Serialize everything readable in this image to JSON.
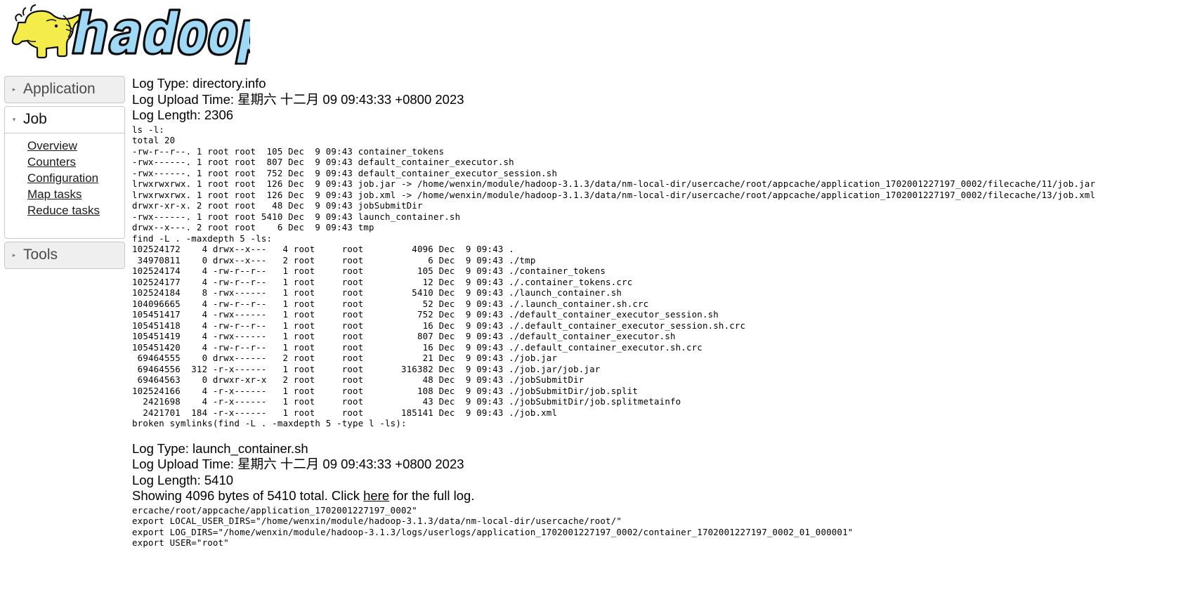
{
  "brand": {
    "name": "hadoop",
    "logo_text": "hadoop",
    "elephant_color": "#f3ec4a",
    "text_color": "#9fd9f6",
    "outline_color": "#000000"
  },
  "sidebar": {
    "sections": [
      {
        "label": "Application",
        "expanded": false,
        "arrow": "▸"
      },
      {
        "label": "Job",
        "expanded": true,
        "arrow": "▾"
      },
      {
        "label": "Tools",
        "expanded": false,
        "arrow": "▸"
      }
    ],
    "job_links": [
      {
        "label": "Overview"
      },
      {
        "label": "Counters"
      },
      {
        "label": "Configuration"
      },
      {
        "label": "Map tasks"
      },
      {
        "label": "Reduce tasks"
      }
    ]
  },
  "logs": [
    {
      "type_label": "Log Type: directory.info",
      "upload_time_label": "Log Upload Time: 星期六 十二月 09 09:43:33 +0800 2023",
      "length_label": "Log Length: 2306",
      "body": "ls -l:\ntotal 20\n-rw-r--r--. 1 root root  105 Dec  9 09:43 container_tokens\n-rwx------. 1 root root  807 Dec  9 09:43 default_container_executor.sh\n-rwx------. 1 root root  752 Dec  9 09:43 default_container_executor_session.sh\nlrwxrwxrwx. 1 root root  126 Dec  9 09:43 job.jar -> /home/wenxin/module/hadoop-3.1.3/data/nm-local-dir/usercache/root/appcache/application_1702001227197_0002/filecache/11/job.jar\nlrwxrwxrwx. 1 root root  126 Dec  9 09:43 job.xml -> /home/wenxin/module/hadoop-3.1.3/data/nm-local-dir/usercache/root/appcache/application_1702001227197_0002/filecache/13/job.xml\ndrwxr-xr-x. 2 root root   48 Dec  9 09:43 jobSubmitDir\n-rwx------. 1 root root 5410 Dec  9 09:43 launch_container.sh\ndrwx--x---. 2 root root    6 Dec  9 09:43 tmp\nfind -L . -maxdepth 5 -ls:\n102524172    4 drwx--x---   4 root     root         4096 Dec  9 09:43 .\n 34970811    0 drwx--x---   2 root     root            6 Dec  9 09:43 ./tmp\n102524174    4 -rw-r--r--   1 root     root          105 Dec  9 09:43 ./container_tokens\n102524177    4 -rw-r--r--   1 root     root           12 Dec  9 09:43 ./.container_tokens.crc\n102524184    8 -rwx------   1 root     root         5410 Dec  9 09:43 ./launch_container.sh\n104096665    4 -rw-r--r--   1 root     root           52 Dec  9 09:43 ./.launch_container.sh.crc\n105451417    4 -rwx------   1 root     root          752 Dec  9 09:43 ./default_container_executor_session.sh\n105451418    4 -rw-r--r--   1 root     root           16 Dec  9 09:43 ./.default_container_executor_session.sh.crc\n105451419    4 -rwx------   1 root     root          807 Dec  9 09:43 ./default_container_executor.sh\n105451420    4 -rw-r--r--   1 root     root           16 Dec  9 09:43 ./.default_container_executor.sh.crc\n 69464555    0 drwx------   2 root     root           21 Dec  9 09:43 ./job.jar\n 69464556  312 -r-x------   1 root     root       316382 Dec  9 09:43 ./job.jar/job.jar\n 69464563    0 drwxr-xr-x   2 root     root           48 Dec  9 09:43 ./jobSubmitDir\n102524166    4 -r-x------   1 root     root          108 Dec  9 09:43 ./jobSubmitDir/job.split\n  2421698    4 -r-x------   1 root     root           43 Dec  9 09:43 ./jobSubmitDir/job.splitmetainfo\n  2421701  184 -r-x------   1 root     root       185141 Dec  9 09:43 ./job.xml\nbroken symlinks(find -L . -maxdepth 5 -type l -ls):\n"
    },
    {
      "type_label": "Log Type: launch_container.sh",
      "upload_time_label": "Log Upload Time: 星期六 十二月 09 09:43:33 +0800 2023",
      "length_label": "Log Length: 5410",
      "showing_prefix": "Showing 4096 bytes of 5410 total. Click ",
      "showing_link": "here",
      "showing_suffix": " for the full log.",
      "body": "ercache/root/appcache/application_1702001227197_0002\"\nexport LOCAL_USER_DIRS=\"/home/wenxin/module/hadoop-3.1.3/data/nm-local-dir/usercache/root/\"\nexport LOG_DIRS=\"/home/wenxin/module/hadoop-3.1.3/logs/userlogs/application_1702001227197_0002/container_1702001227197_0002_01_000001\"\nexport USER=\"root\""
    }
  ]
}
